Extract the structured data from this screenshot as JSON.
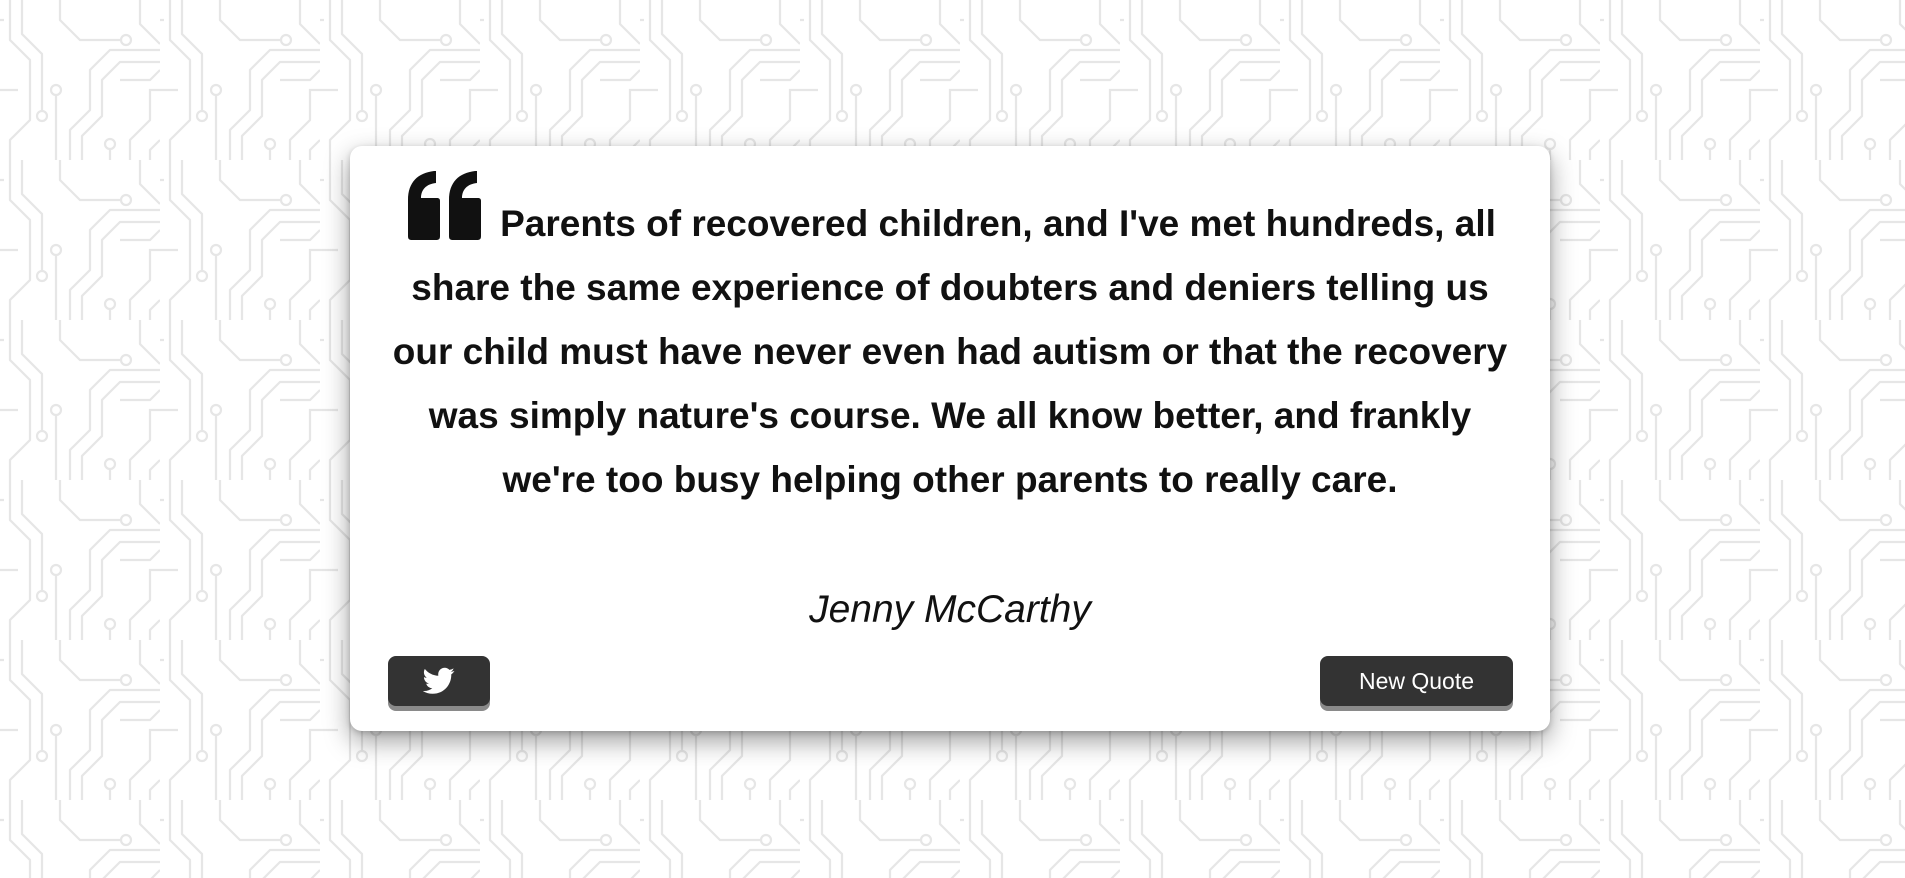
{
  "background": {
    "color": "#ffffff",
    "pattern_line_color": "#e6e6e6",
    "pattern": "circuit-board"
  },
  "quote": {
    "icon": "quote-left-icon",
    "text": "Parents of recovered children, and I've met hundreds, all share the same experience of doubters and deniers telling us our child must have never even had autism or that the recovery was simply nature's course. We all know better, and frankly we're too busy helping other parents to really care.",
    "author": "Jenny McCarthy"
  },
  "buttons": {
    "tweet": {
      "icon": "twitter-icon"
    },
    "new_quote": {
      "label": "New Quote"
    },
    "color": "#333333",
    "text_color": "#ffffff"
  }
}
